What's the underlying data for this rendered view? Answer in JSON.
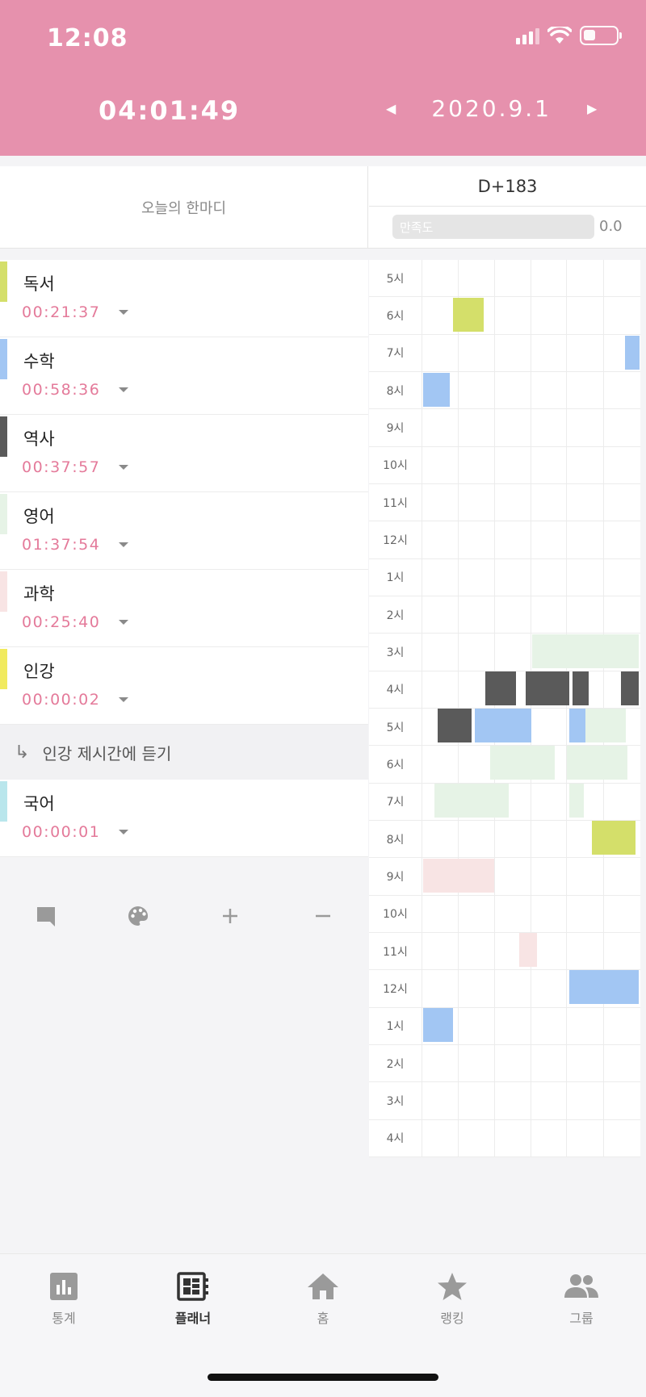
{
  "status": {
    "time": "12:08"
  },
  "header": {
    "timer": "04:01:49",
    "date": "2020.9.1",
    "prev_icon": "chevron-left-icon",
    "next_icon": "chevron-right-icon"
  },
  "memo": {
    "placeholder": "오늘의 한마디"
  },
  "dday": {
    "label": "D+183"
  },
  "satisfaction": {
    "label": "만족도",
    "value": "0.0"
  },
  "subjects": [
    {
      "name": "독서",
      "time": "00:21:37",
      "color": "#d4df6a"
    },
    {
      "name": "수학",
      "time": "00:58:36",
      "color": "#a2c6f3"
    },
    {
      "name": "역사",
      "time": "00:37:57",
      "color": "#5a5a5a"
    },
    {
      "name": "영어",
      "time": "01:37:54",
      "color": "#e6f3e6"
    },
    {
      "name": "과학",
      "time": "00:25:40",
      "color": "#f8e4e4"
    },
    {
      "name": "인강",
      "time": "00:00:02",
      "color": "#f1ea5e",
      "subtask": "인강 제시간에 듣기"
    },
    {
      "name": "국어",
      "time": "00:00:01",
      "color": "#b9e6ec"
    }
  ],
  "tools": [
    "comment-icon",
    "palette-icon",
    "plus-icon",
    "minus-icon"
  ],
  "timetable": {
    "hours": [
      "5시",
      "6시",
      "7시",
      "8시",
      "9시",
      "10시",
      "11시",
      "12시",
      "1시",
      "2시",
      "3시",
      "4시",
      "5시",
      "6시",
      "7시",
      "8시",
      "9시",
      "10시",
      "11시",
      "12시",
      "1시",
      "2시",
      "3시",
      "4시"
    ]
  },
  "tabs": [
    {
      "label": "통계",
      "icon": "bar-chart-icon",
      "active": false
    },
    {
      "label": "플래너",
      "icon": "planner-icon",
      "active": true
    },
    {
      "label": "홈",
      "icon": "home-icon",
      "active": false
    },
    {
      "label": "랭킹",
      "icon": "star-icon",
      "active": false
    },
    {
      "label": "그룹",
      "icon": "group-icon",
      "active": false
    }
  ]
}
